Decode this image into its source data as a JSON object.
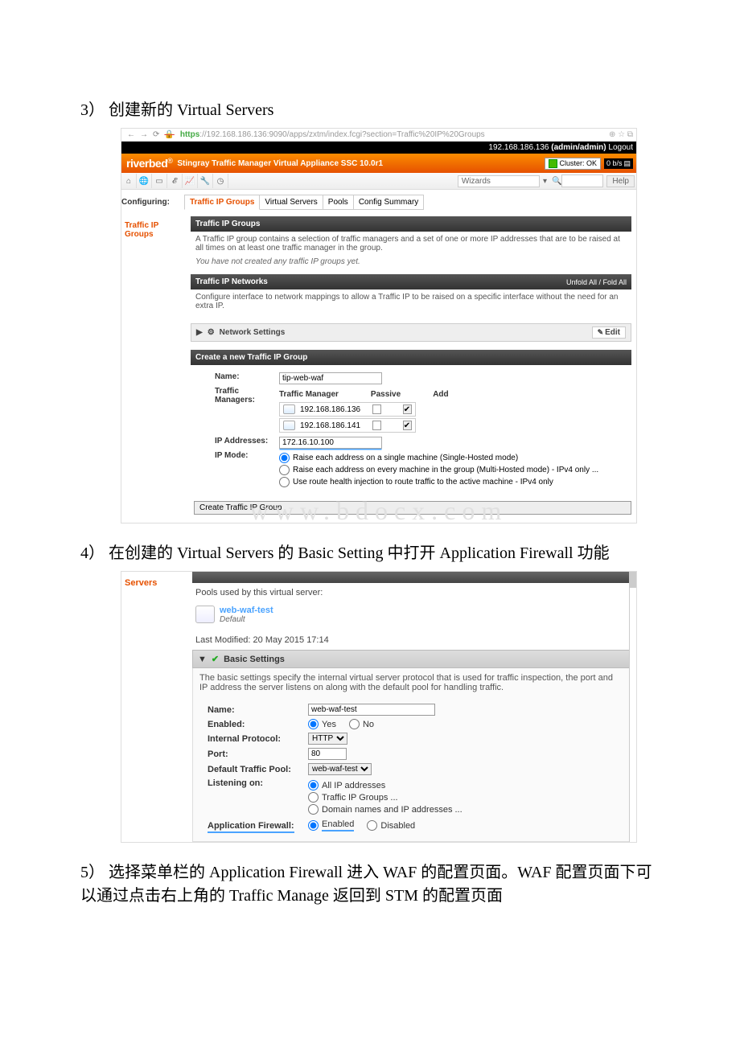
{
  "doc": {
    "heading3": "3） 创建新的 Virtual Servers",
    "heading4": "4） 在创建的 Virtual Servers 的 Basic Setting 中打开 Application Firewall 功能",
    "heading5": "5） 选择菜单栏的 Application Firewall 进入 WAF 的配置页面。WAF 配置页面下可以通过点击右上角的 Traffic Manage 返回到 STM 的配置页面"
  },
  "shot1": {
    "browser": {
      "prefix": "https",
      "url": "://192.168.186.136:9090/apps/zxtm/index.fcgi?section=Traffic%20IP%20Groups",
      "right_icons": "⊕ ☆ ⧉"
    },
    "top": {
      "ip": "192.168.186.136",
      "userinfo": "(admin/admin)",
      "logout": "Logout"
    },
    "brand": "riverbed",
    "brand_sup": "®",
    "appname": "Stingray Traffic Manager Virtual Appliance  SSC   10.0r1",
    "clusterLabel": "Cluster: OK",
    "bps": "0 b/s",
    "wizards": "Wizards",
    "help": "Help",
    "left1": "Configuring:",
    "left2a": "Traffic IP",
    "left2b": "Groups",
    "tabs": {
      "tip": "Traffic IP Groups",
      "vs": "Virtual Servers",
      "pools": "Pools",
      "cs": "Config Summary"
    },
    "sect1": {
      "title": "Traffic IP Groups",
      "desc": "A Traffic IP group contains a selection of traffic managers and a set of one or more IP addresses that are to be raised at all times on at least one traffic manager in the group.",
      "empty": "You have not created any traffic IP groups yet."
    },
    "sect2": {
      "title": "Traffic IP Networks",
      "fold": "Unfold All / Fold All",
      "desc": "Configure interface to network mappings to allow a Traffic IP to be raised on a specific interface without the need for an extra IP.",
      "sub": "Network Settings",
      "edit": "Edit"
    },
    "sect3": {
      "title": "Create a new Traffic IP Group",
      "nameLabel": "Name:",
      "nameVal": "tip-web-waf",
      "tmLabel": "Traffic Managers:",
      "tm_h1": "Traffic Manager",
      "tm_h2": "Passive",
      "tm_h3": "Add",
      "tm1": "192.168.186.136",
      "tm2": "192.168.186.141",
      "ipLabel": "IP Addresses:",
      "ipVal": "172.16.10.100",
      "modeLabel": "IP Mode:",
      "mode1": "Raise each address on a single machine (Single-Hosted mode)",
      "mode2": "Raise each address on every machine in the group (Multi-Hosted mode) - IPv4 only ...",
      "mode3": "Use route health injection to route traffic to the active machine - IPv4 only",
      "createBtn": "Create Traffic IP Group"
    },
    "watermark": "www.bdocx.com"
  },
  "shot2": {
    "left": "Servers",
    "poolsUsed": "Pools used by this virtual server:",
    "poolName": "web-waf-test",
    "poolDefault": "Default",
    "lastMod": "Last Modified: 20 May 2015 17:14",
    "basic": "Basic Settings",
    "desc": "The basic settings specify the internal virtual server protocol that is used for traffic inspection, the port and IP address the server listens on along with the default pool for handling traffic.",
    "nameL": "Name:",
    "nameV": "web-waf-test",
    "enabledL": "Enabled:",
    "yes": "Yes",
    "no": "No",
    "protoL": "Internal Protocol:",
    "protoV": "HTTP",
    "portL": "Port:",
    "portV": "80",
    "poolL": "Default Traffic Pool:",
    "poolSel": "web-waf-test",
    "listenL": "Listening on:",
    "lo1": "All IP addresses",
    "lo2": "Traffic IP Groups ...",
    "lo3": "Domain names and IP addresses ...",
    "afL": "Application Firewall:",
    "afE": "Enabled",
    "afD": "Disabled"
  }
}
